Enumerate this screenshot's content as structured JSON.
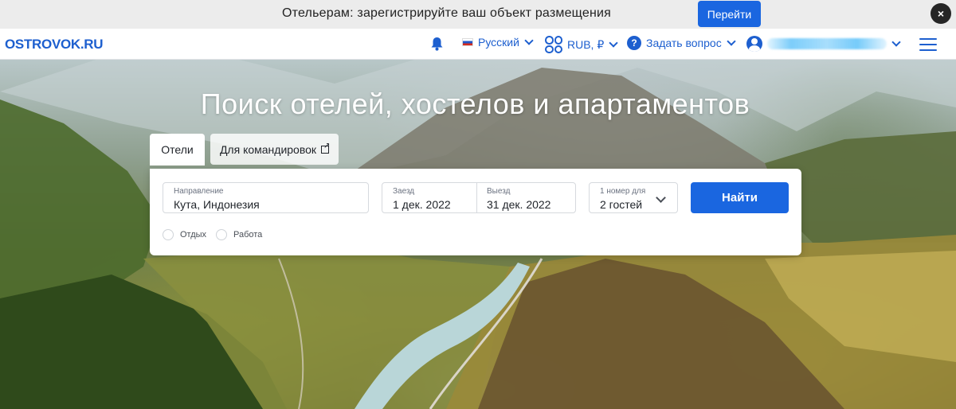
{
  "promo": {
    "text": "Отельерам: зарегистрируйте ваш объект размещения",
    "button": "Перейти",
    "close": "×"
  },
  "header": {
    "logo": "OSTROVOK.RU",
    "language": "Русский",
    "currency": "RUB, ₽",
    "help": "Задать вопрос"
  },
  "hero": {
    "title": "Поиск отелей, хостелов и апартаментов"
  },
  "tabs": [
    {
      "label": "Отели",
      "active": true
    },
    {
      "label": "Для командировок",
      "active": false
    }
  ],
  "search": {
    "destination_label": "Направление",
    "destination_value": "Кута, Индонезия",
    "checkin_label": "Заезд",
    "checkin_value": "1 дек. 2022",
    "checkout_label": "Выезд",
    "checkout_value": "31 дек. 2022",
    "guests_label": "1 номер для",
    "guests_value": "2 гостей",
    "submit": "Найти",
    "purpose_options": [
      "Отдых",
      "Работа"
    ]
  },
  "colors": {
    "accent": "#1a66e0",
    "logo": "#1d5fcf",
    "banner_bg": "#ececec"
  }
}
